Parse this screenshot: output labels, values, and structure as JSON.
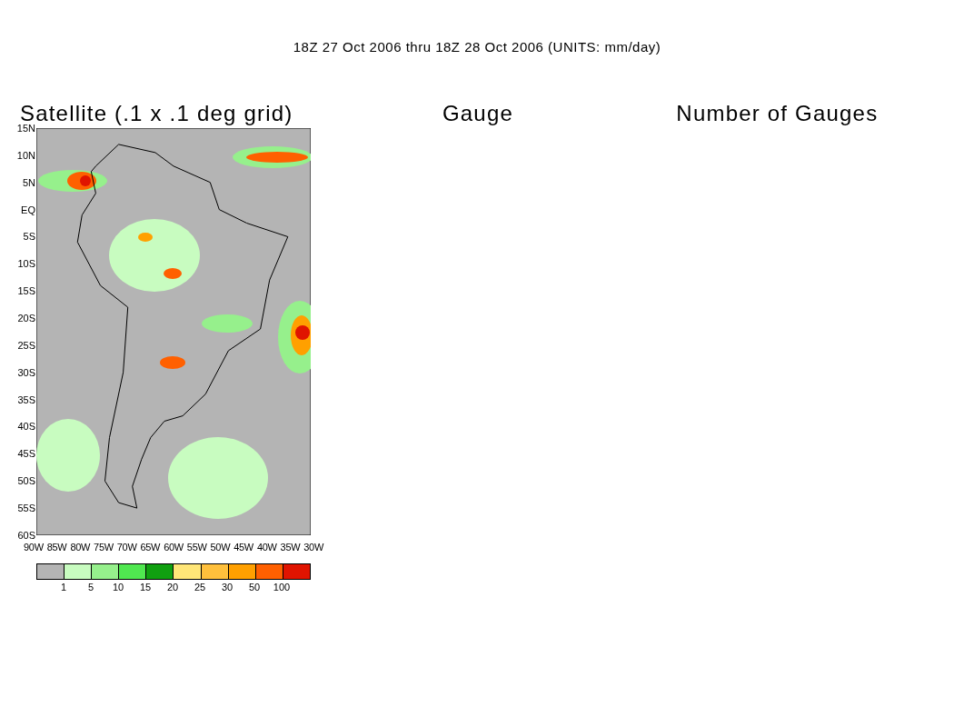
{
  "title": "18Z 27 Oct 2006 thru 18Z 28 Oct 2006 (UNITS: mm/day)",
  "panels": [
    {
      "kind": "map",
      "title": "Satellite (.1 x .1 deg grid)",
      "lat_labels": [
        "15N",
        "10N",
        "5N",
        "EQ",
        "5S",
        "10S",
        "15S",
        "20S",
        "25S",
        "30S",
        "35S",
        "40S",
        "45S",
        "50S",
        "55S",
        "60S"
      ],
      "lon_labels": [
        "90W",
        "85W",
        "80W",
        "75W",
        "70W",
        "65W",
        "60W",
        "55W",
        "50W",
        "45W",
        "40W",
        "35W",
        "30W"
      ],
      "legend": {
        "bins": [
          {
            "color": "#b4b4b4"
          },
          {
            "color": "#c8fcc0"
          },
          {
            "color": "#96f08c"
          },
          {
            "color": "#50e850"
          },
          {
            "color": "#10a010"
          },
          {
            "color": "#ffe678"
          },
          {
            "color": "#ffc03c"
          },
          {
            "color": "#ffa000"
          },
          {
            "color": "#ff6000"
          },
          {
            "color": "#e01400"
          }
        ],
        "labels": [
          "1",
          "5",
          "10",
          "15",
          "20",
          "25",
          "30",
          "50",
          "100"
        ]
      }
    },
    {
      "kind": "empty",
      "title": "Gauge"
    },
    {
      "kind": "empty",
      "title": "Number of Gauges"
    }
  ]
}
